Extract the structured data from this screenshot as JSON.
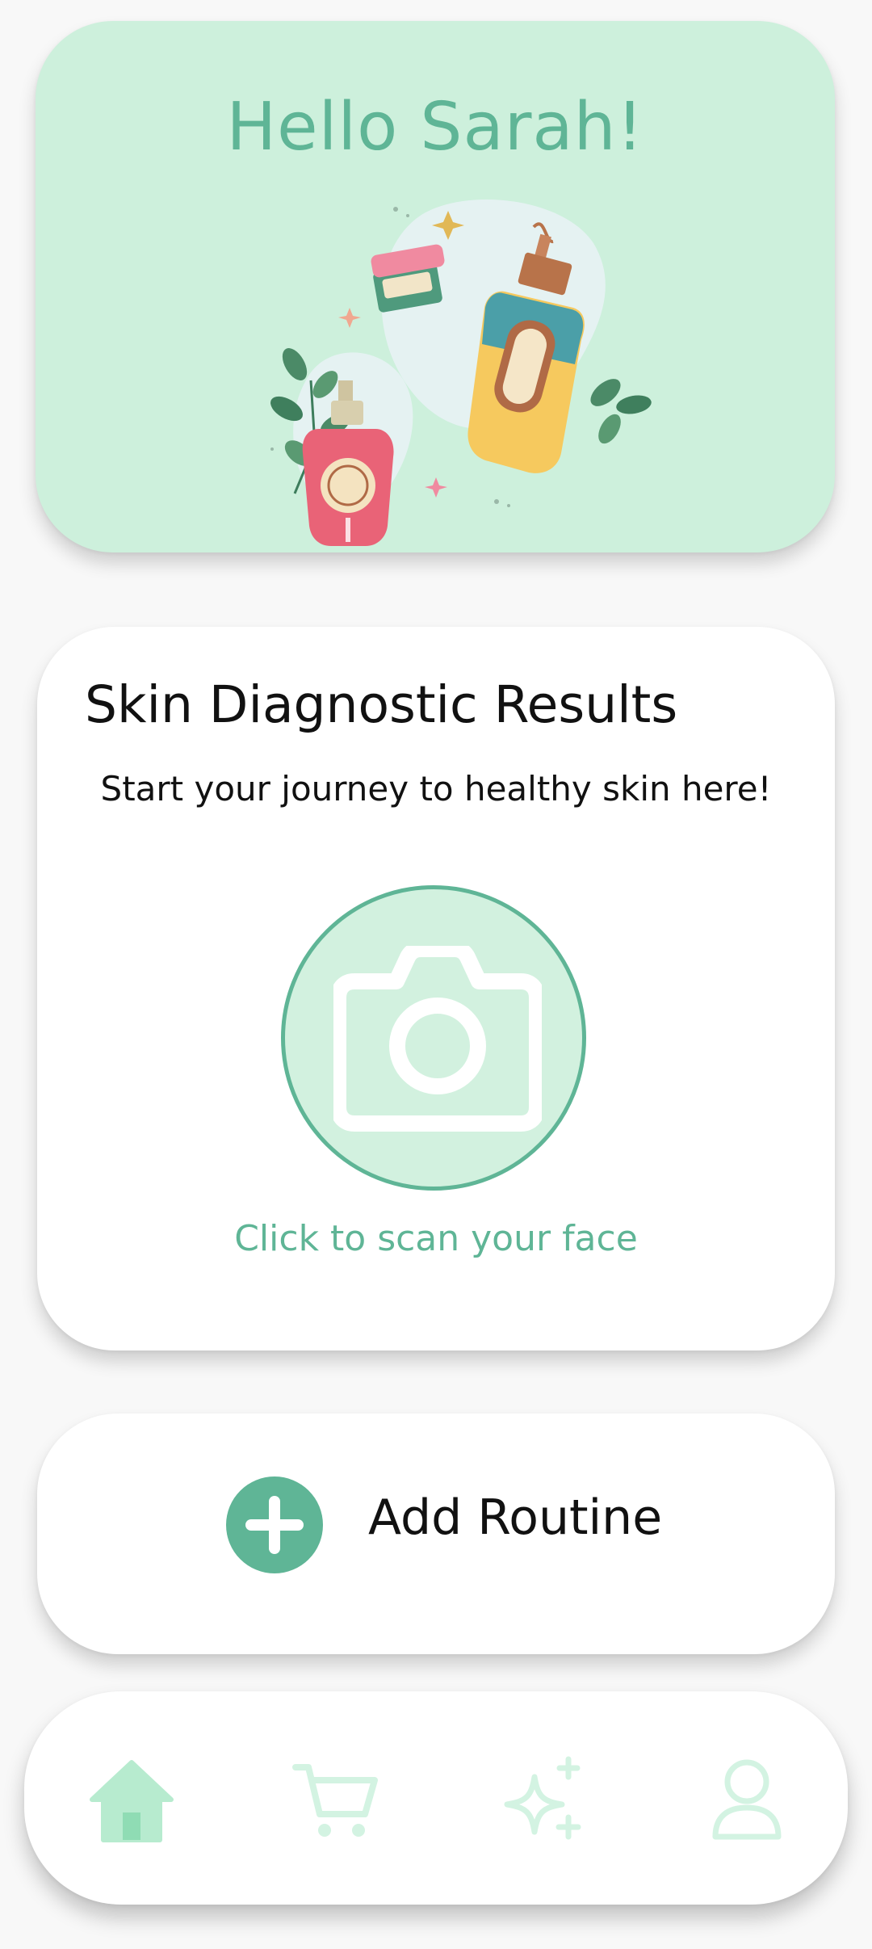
{
  "greeting": {
    "title": "Hello Sarah!"
  },
  "diagnostic": {
    "title": "Skin Diagnostic Results",
    "subtitle": "Start your journey to healthy skin here!",
    "scan_caption": "Click to scan your face",
    "scan_icon": "camera-icon"
  },
  "routine": {
    "label": "Add Routine",
    "icon": "plus-circle-icon"
  },
  "nav": {
    "items": [
      {
        "icon": "home-icon",
        "active": true
      },
      {
        "icon": "cart-icon",
        "active": false
      },
      {
        "icon": "sparkles-icon",
        "active": false
      },
      {
        "icon": "user-icon",
        "active": false
      }
    ]
  },
  "colors": {
    "accent": "#5fb596",
    "mint_background": "#cdf0dc",
    "nav_icon_active": "#b7ebcf",
    "nav_icon_inactive": "#d3f3e2"
  }
}
